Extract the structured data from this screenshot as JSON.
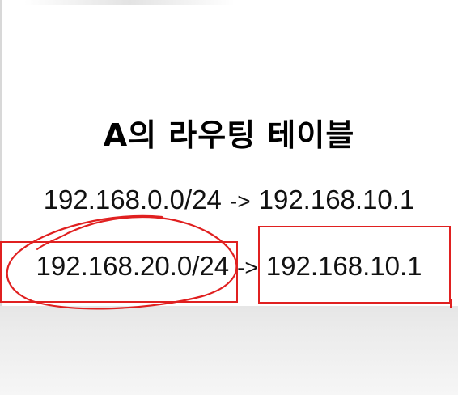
{
  "slide": {
    "title": "A의 라우팅 테이블",
    "routes": [
      {
        "destination": "192.168.0.0/24",
        "arrow": "->",
        "next_hop": "192.168.10.1"
      },
      {
        "destination": "192.168.20.0/24",
        "arrow": "->",
        "next_hop": "192.168.10.1"
      }
    ]
  },
  "colors": {
    "annotation": "#e02020",
    "text": "#111111"
  }
}
